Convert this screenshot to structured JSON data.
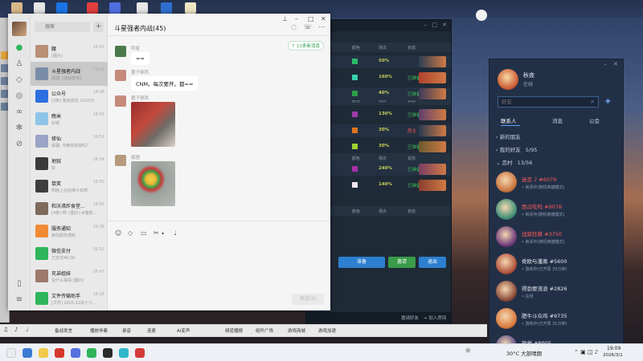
{
  "chat": {
    "title": "斗星强者内战(45)",
    "search_placeholder": "搜索",
    "add_label": "+",
    "notice": "↑ 11条新消息",
    "send_label": "发送(S)",
    "conversations": [
      {
        "name": "腰",
        "preview": "[图片]",
        "time": "18:53",
        "color": "#b89076"
      },
      {
        "name": "斗星强者内战",
        "preview": "狐狸: [动画表情]",
        "time": "19:06",
        "color": "#7a8da8",
        "selected": true
      },
      {
        "name": "公众号",
        "preview": "[3条] 我叔叔说 1010分...",
        "time": "18:08",
        "color": "#2d6fe0"
      },
      {
        "name": "晚米",
        "preview": "好呢",
        "time": "18:54",
        "color": "#8ec4e8"
      },
      {
        "name": "修仙",
        "preview": "狐狸: 今晚你有搞吗?",
        "time": "18:51",
        "color": "#9aa5c6"
      },
      {
        "name": "地狱",
        "preview": "好",
        "time": "18:54",
        "color": "#3a3a3a"
      },
      {
        "name": "鼠笑",
        "preview": "明晚上分后续子去啊",
        "time": "18:50",
        "color": "#3e3e3e"
      },
      {
        "name": "和沃沸炸食堂...",
        "preview": "[4条] 啊: [图片] #猫老...",
        "time": "18:42",
        "color": "#7d6b5c"
      },
      {
        "name": "服务通知",
        "preview": "微信服务通知",
        "time": "18:38",
        "color": "#f08a33"
      },
      {
        "name": "微信支付",
        "preview": "已支付46.00",
        "time": "16:52",
        "color": "#2fb55a"
      },
      {
        "name": "兄弟姐妹",
        "preview": "没什么事情 [图片]",
        "time": "16:47",
        "color": "#9c7a6c"
      },
      {
        "name": "文件传输助手",
        "preview": "[文件] 2025.12是十六...",
        "time": "16:28",
        "color": "#2fb55a"
      }
    ],
    "messages": [
      {
        "sender": "阿星",
        "text": "==",
        "type": "text"
      },
      {
        "sender": "罢子顿西",
        "text": "CNM。每次要开。都==",
        "type": "text"
      },
      {
        "sender": "罢子顿西",
        "type": "image"
      },
      {
        "sender": "狐狸",
        "type": "image"
      }
    ]
  },
  "game": {
    "headers": [
      "颜色",
      "场次",
      "状态"
    ],
    "rows": [
      {
        "pct": "50%",
        "color": "#2bbb6a",
        "status": "",
        "status_color": "#3fc85a",
        "art": "#2c3d52"
      },
      {
        "pct": "160%",
        "color": "#37d0a9",
        "status": "已准备",
        "status_color": "#3fc85a",
        "art": "#b0422e"
      },
      {
        "pct": "40%",
        "color": "#2f9e4a",
        "status": "已准备",
        "status_color": "#3fc85a",
        "art": "#3e3a58"
      },
      {
        "pct": "130%",
        "color": "#9e3aa8",
        "status": "已准备",
        "status_color": "#3fc85a",
        "art": "#5d3f6e"
      },
      {
        "pct": "30%",
        "color": "#e07520",
        "status": "房主",
        "status_color": "#ff5a5a",
        "art": "#2a3b50"
      },
      {
        "pct": "30%",
        "color": "#9ed030",
        "status": "已准备",
        "status_color": "#3fc85a",
        "art": "#6a5a2e"
      },
      {
        "pct": "240%",
        "color": "#a82fa9",
        "status": "已准备",
        "status_color": "#3fc85a",
        "art": "#7a3c63"
      },
      {
        "pct": "140%",
        "color": "#f1e6ef",
        "status": "已准备",
        "status_color": "#3fc85a",
        "art": "#8a3f2f"
      }
    ],
    "buttons": {
      "ready": "准备",
      "invite": "邀请",
      "exit": "退出"
    },
    "footer": {
      "left": "邀请好友",
      "right": "+ 加入房间"
    }
  },
  "qq": {
    "profile": {
      "name": "秋夜",
      "status": "在线"
    },
    "search_placeholder": "好友",
    "tabs": [
      "联系人",
      "消息",
      "公会"
    ],
    "groups": [
      {
        "label": "新的朋友"
      },
      {
        "label": "我的好友",
        "count": "5/95"
      },
      {
        "label": "恋村",
        "count": "13/56"
      }
    ],
    "friends": [
      {
        "name": "迷恋 ♪ #6079",
        "status": "• 房间中(随机英雄模式)",
        "red": true,
        "color": "#c8743d"
      },
      {
        "name": "西瓜吃吗 #9078",
        "status": "• 房间中(随机英雄模式)",
        "red": true,
        "color": "#3f8f77"
      },
      {
        "name": "战狼狂飙 #3750",
        "status": "• 房间中(随机英雄模式)",
        "red": true,
        "color": "#6e3a7a"
      },
      {
        "name": "奇欧与潘离 #5600",
        "status": "• 游戏中(已开局 33分钟)",
        "red": false,
        "color": "#b0513a"
      },
      {
        "name": "得劲要流浪 #2826",
        "status": "• 在线",
        "red": false,
        "color": "#8b4b3a"
      },
      {
        "name": "肥牛斗众鸡 #9735",
        "status": "• 游戏中(已开局 31分钟)",
        "red": false,
        "color": "#d97a3c"
      },
      {
        "name": "政党 #8905",
        "status": "• 游戏中(已开局 31分钟)",
        "red": false,
        "color": "#5e4c8a"
      }
    ]
  },
  "toolbar": {
    "items": [
      "备战发言",
      "播放伴奏",
      "录音",
      "连麦",
      "AI变声",
      "频道播报",
      "组件广场",
      "游戏商城",
      "游戏加速"
    ]
  },
  "taskbar": {
    "weather": "30°C 大部晴朗",
    "time": "19:09",
    "date": "2026/3/1"
  }
}
